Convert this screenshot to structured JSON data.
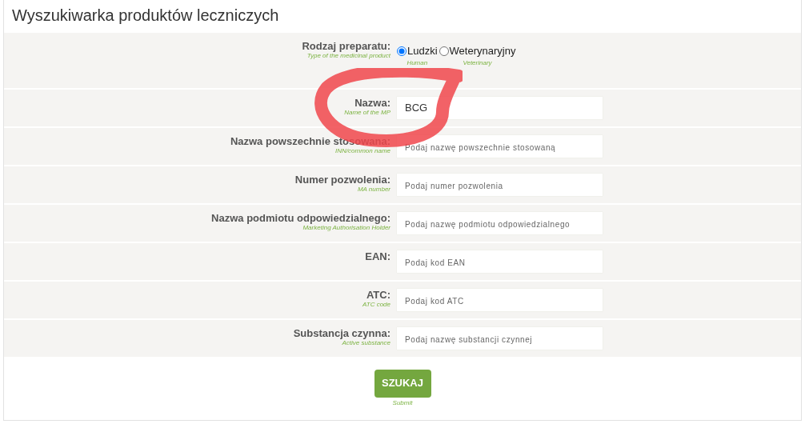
{
  "title": "Wyszukiwarka produktów leczniczych",
  "product_type": {
    "label": "Rodzaj preparatu:",
    "hint": "Type of the medicinal product",
    "options": [
      {
        "label": "Ludzki",
        "hint": "Human",
        "selected": true
      },
      {
        "label": "Weterynaryjny",
        "hint": "Veterinary",
        "selected": false
      }
    ]
  },
  "fields": [
    {
      "label": "Nazwa:",
      "hint": "Name of the MP",
      "value": "BCG"
    },
    {
      "label": "Nazwa powszechnie stosowana:",
      "hint": "INN/common name",
      "placeholder": "Podaj nazwę powszechnie stosowaną"
    },
    {
      "label": "Numer pozwolenia:",
      "hint": "MA number",
      "placeholder": "Podaj numer pozwolenia"
    },
    {
      "label": "Nazwa podmiotu odpowiedzialnego:",
      "hint": "Marketing Authorisation Holder",
      "placeholder": "Podaj nazwę podmiotu odpowiedzialnego"
    },
    {
      "label": "EAN:",
      "placeholder": "Podaj kod EAN"
    },
    {
      "label": "ATC:",
      "hint": "ATC code",
      "placeholder": "Podaj kod ATC"
    },
    {
      "label": "Substancja czynna:",
      "hint": "Active substance",
      "placeholder": "Podaj nazwę substancji czynnej"
    }
  ],
  "submit": {
    "label": "SZUKAJ",
    "hint": "Submit"
  }
}
